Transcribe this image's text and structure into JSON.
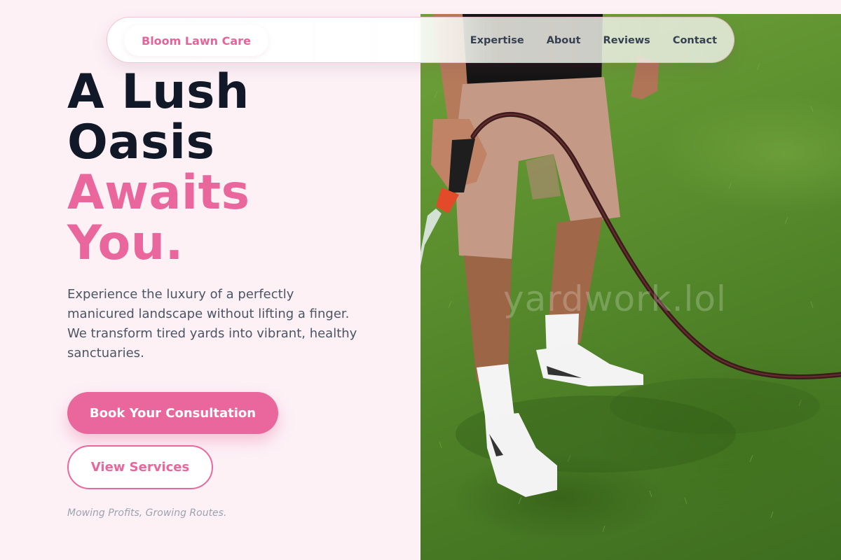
{
  "brand": {
    "name": "Bloom Lawn Care"
  },
  "nav": {
    "links": [
      "Expertise",
      "About",
      "Reviews",
      "Contact"
    ]
  },
  "hero": {
    "headline_dark_1": "A Lush",
    "headline_dark_2": "Oasis",
    "headline_pink_1": "Awaits",
    "headline_pink_2": "You.",
    "description": "Experience the luxury of a perfectly manicured landscape without lifting a finger. We transform tired yards into vibrant, healthy sanctuaries.",
    "primary_cta": "Book Your Consultation",
    "secondary_cta": "View Services",
    "tagline": "Mowing Profits, Growing Routes."
  },
  "image": {
    "watermark": "yardwork.lol",
    "subject": "person-watering-lawn-with-hose"
  },
  "colors": {
    "accent": "#e9679c",
    "heading": "#111827",
    "body_text": "#4b5563",
    "background": "#fdf1f6"
  }
}
